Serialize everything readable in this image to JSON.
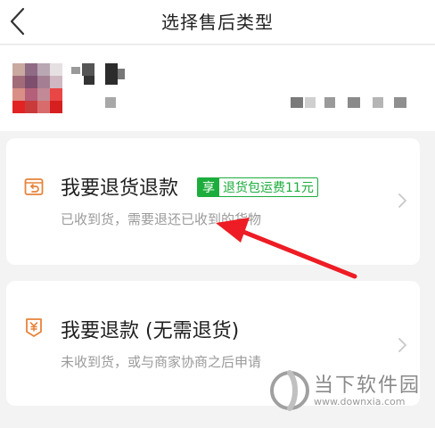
{
  "header": {
    "title": "选择售后类型"
  },
  "options": [
    {
      "title": "我要退货退款",
      "description": "已收到货，需要退还已收到的货物",
      "badge": {
        "tag": "享",
        "text": "退货包运费11元"
      }
    },
    {
      "title": "我要退款 (无需退货)",
      "description": "未收到货，或与商家协商之后申请"
    }
  ],
  "colors": {
    "badge_green": "#1cad3c",
    "icon_orange": "#e8833a",
    "annotation_red": "#ee1c24"
  },
  "watermark": {
    "name": "当下软件园",
    "url": "www.downxia.com"
  }
}
